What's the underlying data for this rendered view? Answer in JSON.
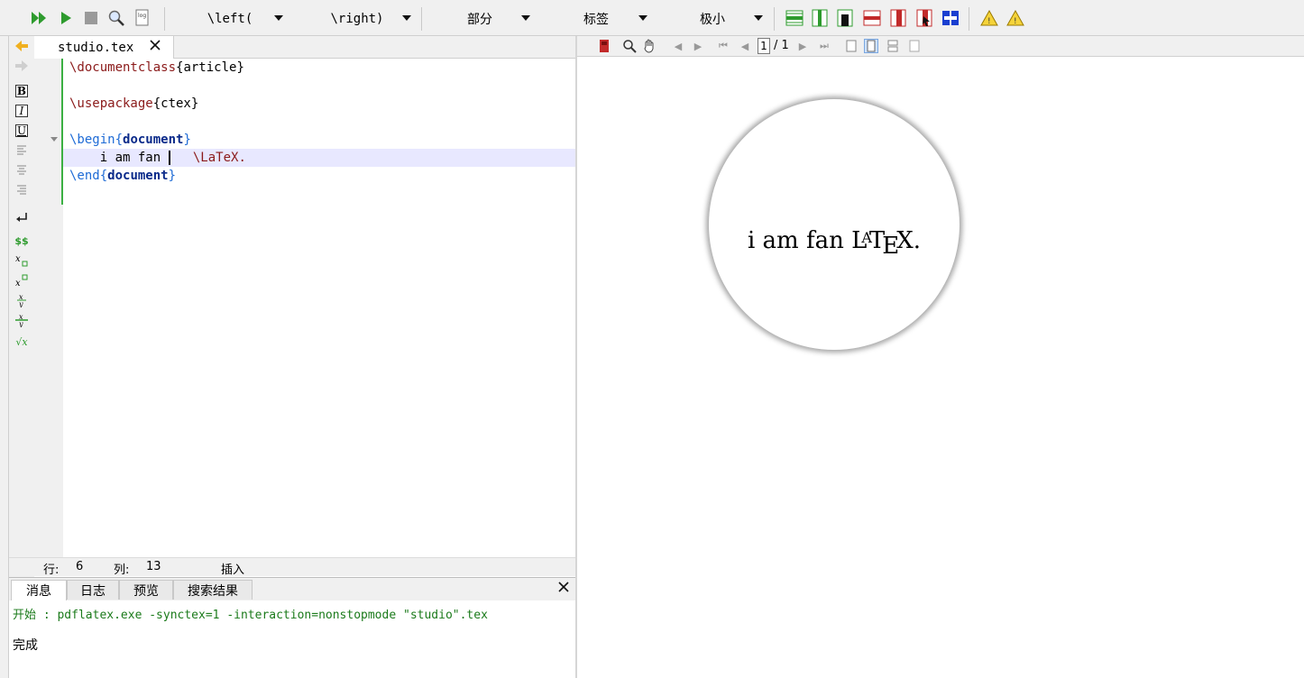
{
  "toolbar": {
    "left_combo": "\\left(",
    "right_combo": "\\right)",
    "section_combo": "部分",
    "label_combo": "标签",
    "size_combo": "极小"
  },
  "icons": {
    "compile": "double-play-icon",
    "run": "play-icon",
    "stop": "stop-icon",
    "view": "magnifier-icon",
    "log": "log-icon",
    "accent_green": "#2e9b2e",
    "accent_red": "#c22a2a",
    "accent_blue": "#1a3fd0"
  },
  "symbols": {
    "bold": "B",
    "italic": "I",
    "underline": "U",
    "math": "$$",
    "sqrt": "√x"
  },
  "editor": {
    "tab_label": "studio.tex",
    "lines": {
      "l1_cmd": "\\documentclass",
      "l1_arg": "{article}",
      "l3_cmd": "\\usepackage",
      "l3_arg": "{ctex}",
      "l5_cmd": "\\begin",
      "l5_open": "{",
      "l5_env": "document",
      "l5_close": "}",
      "l6_text": "    i am fan ",
      "l6_cmd": "\\LaTeX.",
      "l7_cmd": "\\end",
      "l7_open": "{",
      "l7_env": "document",
      "l7_close": "}"
    }
  },
  "status": {
    "row_label": "行:",
    "row_value": "6",
    "col_label": "列:",
    "col_value": "13",
    "mode": "插入"
  },
  "messages": {
    "tabs": [
      "消息",
      "日志",
      "预览",
      "搜索结果"
    ],
    "line1": "开始 : pdflatex.exe -synctex=1 -interaction=nonstopmode \"studio\".tex",
    "line2": "完成"
  },
  "pdf": {
    "page_current": "1",
    "page_total": "/ 1",
    "preview_text": "i am fan",
    "logo": "LaTeX",
    "logo_L": "L",
    "logo_A": "A",
    "logo_T": "T",
    "logo_E": "E",
    "logo_X": "X."
  }
}
